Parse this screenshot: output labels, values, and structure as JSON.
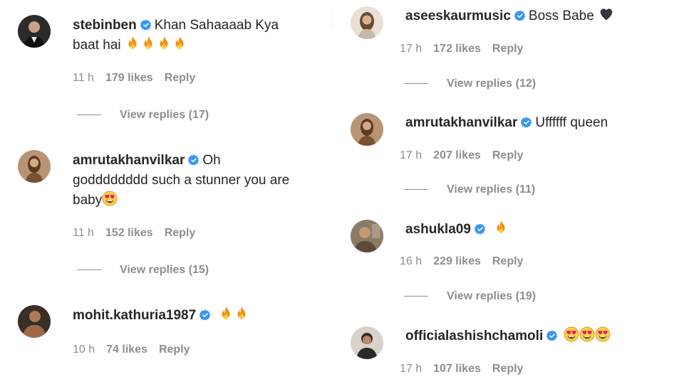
{
  "comments_left": [
    {
      "username": "stebinben",
      "line1": "Khan Sahaaaab Kya",
      "line2": "baat hai",
      "emoji": "fire-x4",
      "time": "11 h",
      "likes": "179 likes",
      "reply": "Reply",
      "view_replies": "View replies (17)"
    },
    {
      "username": "amrutakhanvilkar",
      "line1": "Oh",
      "line2": "godddddddd such a stunner you are",
      "line3": "baby",
      "emoji": "heart-eyes-x1",
      "time": "11 h",
      "likes": "152 likes",
      "reply": "Reply",
      "view_replies": "View replies (15)"
    },
    {
      "username": "mohit.kathuria1987",
      "line1": "",
      "emoji": "fire-x2",
      "time": "10 h",
      "likes": "74 likes",
      "reply": "Reply"
    }
  ],
  "comments_right": [
    {
      "username": "aseeskaurmusic",
      "line1": "Boss Babe",
      "emoji": "black-heart",
      "time": "17 h",
      "likes": "172 likes",
      "reply": "Reply",
      "view_replies": "View replies (12)"
    },
    {
      "username": "amrutakhanvilkar",
      "line1": "Uffffff queen",
      "time": "17 h",
      "likes": "207 likes",
      "reply": "Reply",
      "view_replies": "View replies (11)"
    },
    {
      "username": "ashukla09",
      "line1": "",
      "emoji": "fire-x1",
      "time": "16 h",
      "likes": "229 likes",
      "reply": "Reply",
      "view_replies": "View replies (19)"
    },
    {
      "username": "officialashishchamoli",
      "line1": "",
      "emoji": "heart-eyes-x3",
      "time": "17 h",
      "likes": "107 likes",
      "reply": "Reply"
    }
  ],
  "colors": {
    "text": "#262626",
    "muted": "#8e8e8e",
    "verified": "#3897f0"
  }
}
